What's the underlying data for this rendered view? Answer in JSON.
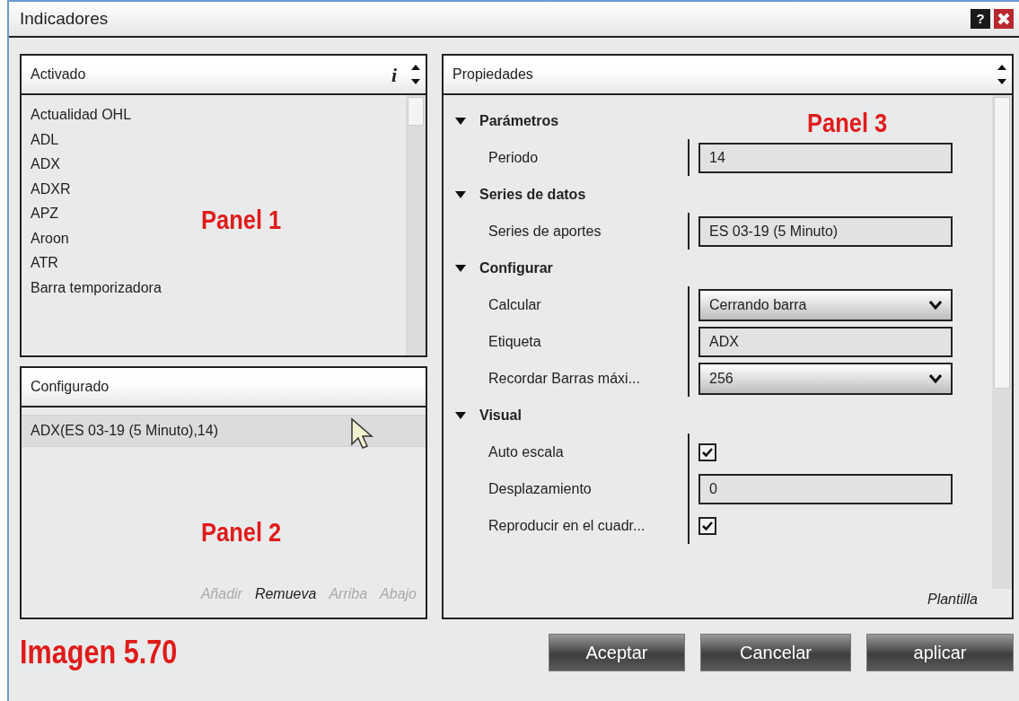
{
  "window": {
    "title": "Indicadores",
    "help_button": "?"
  },
  "activated": {
    "title": "Activado",
    "info": "i",
    "annotation": "Panel 1",
    "items": [
      {
        "label": "Actualidad OHL"
      },
      {
        "label": "ADL"
      },
      {
        "label": "ADX"
      },
      {
        "label": "ADXR"
      },
      {
        "label": "APZ"
      },
      {
        "label": "Aroon"
      },
      {
        "label": "ATR"
      },
      {
        "label": "Barra temporizadora"
      }
    ]
  },
  "configured": {
    "title": "Configurado",
    "annotation": "Panel 2",
    "items": [
      {
        "label": "ADX(ES 03-19 (5 Minuto),14)",
        "selected": true
      }
    ],
    "actions": [
      {
        "label": "Añadir",
        "disabled": true
      },
      {
        "label": "Remueva",
        "disabled": false
      },
      {
        "label": "Arriba",
        "disabled": true
      },
      {
        "label": "Abajo",
        "disabled": true
      }
    ]
  },
  "properties": {
    "title": "Propiedades",
    "annotation": "Panel 3",
    "template_link": "Plantilla",
    "categories": [
      {
        "name": "Parámetros",
        "expanded": true,
        "properties": [
          {
            "label": "Periodo",
            "kind": "text",
            "value": "14"
          }
        ]
      },
      {
        "name": "Series de datos",
        "expanded": true,
        "properties": [
          {
            "label": "Series de aportes",
            "kind": "text",
            "value": "ES 03-19 (5 Minuto)"
          }
        ]
      },
      {
        "name": "Configurar",
        "expanded": true,
        "properties": [
          {
            "label": "Calcular",
            "kind": "select",
            "value": "Cerrando barra"
          },
          {
            "label": "Etiqueta",
            "kind": "text",
            "value": "ADX"
          },
          {
            "label": "Recordar Barras máxi...",
            "kind": "select",
            "value": "256"
          }
        ]
      },
      {
        "name": "Visual",
        "expanded": true,
        "properties": [
          {
            "label": "Auto escala",
            "kind": "checkbox",
            "checked": true
          },
          {
            "label": "Desplazamiento",
            "kind": "text",
            "value": "0"
          },
          {
            "label": "Reproducir en el cuadr...",
            "kind": "checkbox",
            "checked": true
          }
        ]
      }
    ]
  },
  "figure_caption": "Imagen 5.70",
  "buttons": [
    "Aceptar",
    "Cancelar",
    "aplicar"
  ]
}
